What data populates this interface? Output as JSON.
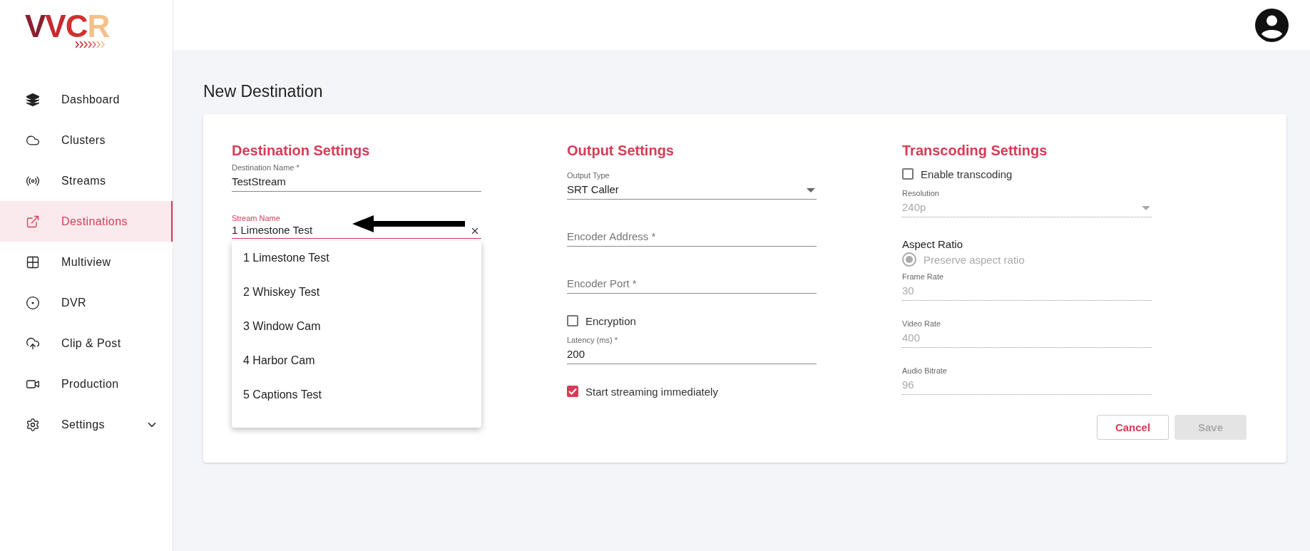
{
  "logo": {
    "text": "VVCR"
  },
  "sidebar": {
    "items": [
      {
        "label": "Dashboard",
        "selected": false
      },
      {
        "label": "Clusters",
        "selected": false
      },
      {
        "label": "Streams",
        "selected": false
      },
      {
        "label": "Destinations",
        "selected": true
      },
      {
        "label": "Multiview",
        "selected": false
      },
      {
        "label": "DVR",
        "selected": false
      },
      {
        "label": "Clip & Post",
        "selected": false
      },
      {
        "label": "Production",
        "selected": false
      },
      {
        "label": "Settings",
        "selected": false,
        "expanded": false
      }
    ]
  },
  "page_title": "New Destination",
  "sections": [
    {
      "title": "Destination Settings",
      "fields": [
        {
          "kind": "text",
          "label": "Destination Name *",
          "value": "TestStream",
          "disabled": false
        },
        {
          "kind": "combo",
          "label": "Stream Name",
          "value": "1 Limestone Test",
          "expanded": true,
          "options": [
            "1 Limestone Test",
            "2 Whiskey Test",
            "3 Window Cam",
            "4 Harbor Cam",
            "5 Captions Test"
          ]
        }
      ]
    },
    {
      "title": "Output Settings",
      "fields": [
        {
          "kind": "select",
          "label": "Output Type",
          "value": "SRT Caller",
          "disabled": false
        },
        {
          "kind": "text",
          "placeholder": "Encoder Address *",
          "disabled": false
        },
        {
          "kind": "text",
          "placeholder": "Encoder Port *",
          "disabled": false
        },
        {
          "kind": "checkbox",
          "label": "Encryption",
          "checked": false
        },
        {
          "kind": "text",
          "label": "Latency (ms) *",
          "value": "200",
          "disabled": false
        },
        {
          "kind": "checkbox",
          "label": "Start streaming immediately",
          "checked": true
        }
      ]
    },
    {
      "title": "Transcoding Settings",
      "fields": [
        {
          "kind": "checkbox",
          "label": "Enable transcoding",
          "checked": false
        },
        {
          "kind": "select",
          "label": "Resolution",
          "value": "240p",
          "disabled": true
        },
        {
          "kind": "heading",
          "label": "Aspect Ratio"
        },
        {
          "kind": "radio",
          "label": "Preserve aspect ratio",
          "selected": true,
          "disabled": true
        },
        {
          "kind": "text",
          "label": "Frame Rate",
          "value": "30",
          "disabled": true
        },
        {
          "kind": "text",
          "label": "Video Rate",
          "value": "400",
          "disabled": true
        },
        {
          "kind": "text",
          "label": "Audio Bitrate",
          "value": "96",
          "disabled": true
        }
      ]
    }
  ],
  "buttons": [
    {
      "label": "Cancel",
      "kind": "secondary",
      "disabled": false
    },
    {
      "label": "Save",
      "kind": "primary",
      "disabled": true
    }
  ]
}
